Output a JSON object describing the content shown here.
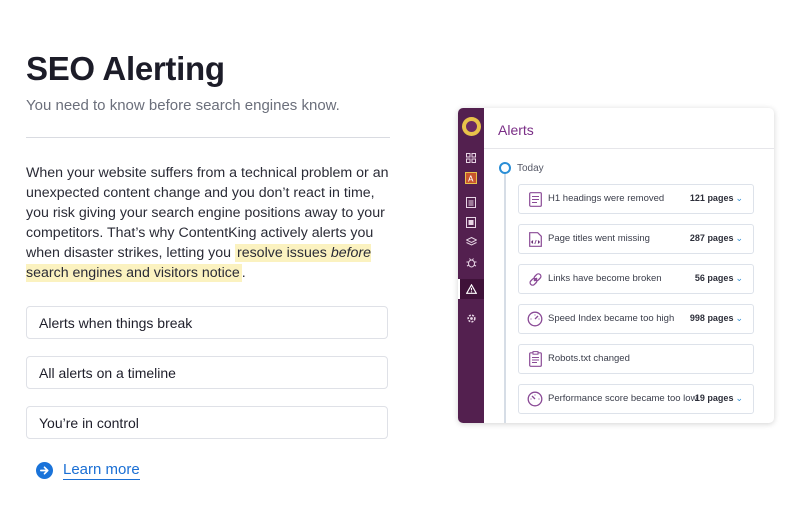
{
  "heading": "SEO Alerting",
  "subheading": "You need to know before search engines know.",
  "intro": {
    "part1": "When your website suffers from a technical problem or an unexpected content change and you don’t react in time, you risk giving your search engine positions away to your competitors. That’s why ContentKing actively alerts you when disaster strikes, letting you ",
    "hl1": "resolve issues ",
    "hl_em": "before",
    "hl2": " search engines and visitors notice",
    "end": "."
  },
  "features": [
    "Alerts when things break",
    "All alerts on a timeline",
    "You’re in control"
  ],
  "learn_more": "Learn more",
  "app": {
    "title": "Alerts",
    "section": "Today",
    "alerts": [
      {
        "icon": "document-icon",
        "label": "H1 headings were removed",
        "count": "121 pages"
      },
      {
        "icon": "code-page-icon",
        "label": "Page titles went missing",
        "count": "287 pages"
      },
      {
        "icon": "link-icon",
        "label": "Links have become broken",
        "count": "56 pages"
      },
      {
        "icon": "speedometer-icon",
        "label": "Speed Index became too high",
        "count": "998 pages"
      },
      {
        "icon": "clipboard-icon",
        "label": "Robots.txt changed",
        "count": ""
      },
      {
        "icon": "speedometer-icon",
        "label": "Performance score became too low",
        "count": "19 pages"
      }
    ]
  },
  "colors": {
    "accent": "#7a2e86",
    "sidebar": "#53204f",
    "link": "#1a6fd4",
    "highlight": "#fbf2c0"
  }
}
